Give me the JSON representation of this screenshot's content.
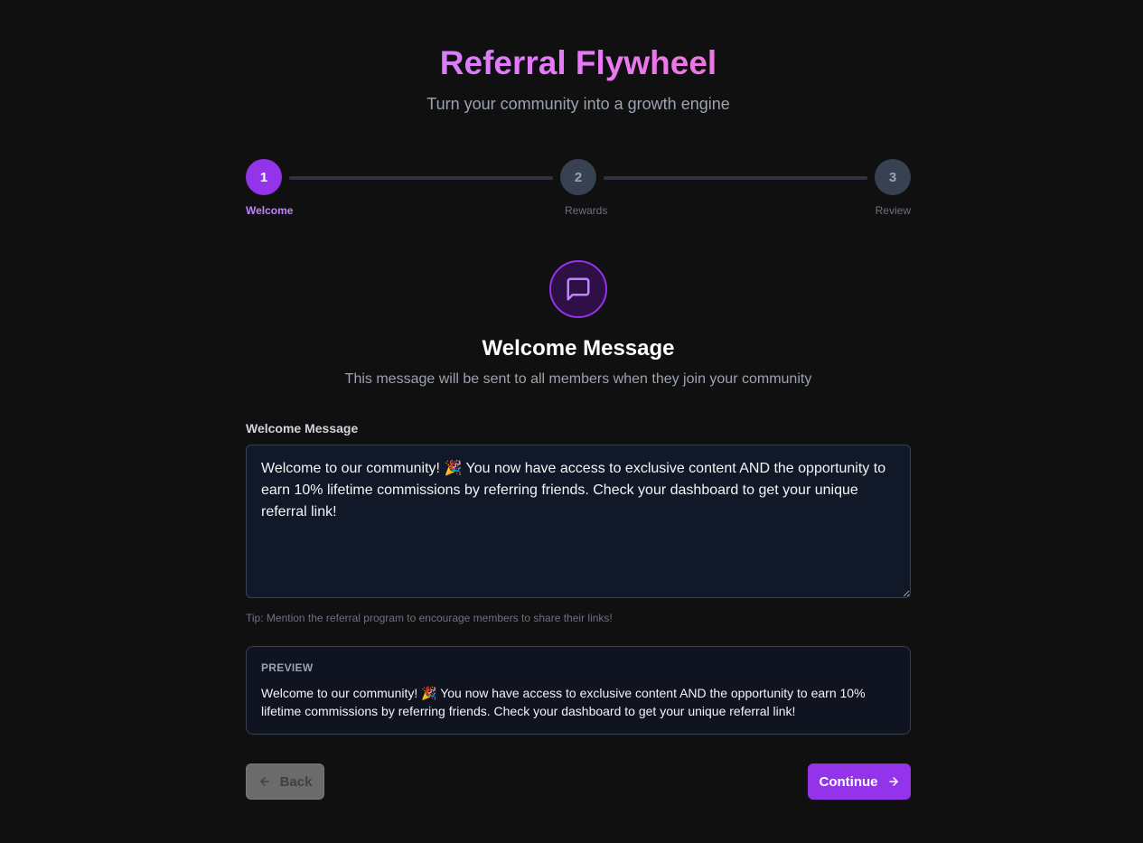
{
  "header": {
    "title": "Referral Flywheel",
    "subtitle": "Turn your community into a growth engine"
  },
  "stepper": {
    "steps": [
      {
        "number": "1",
        "label": "Welcome",
        "state": "active"
      },
      {
        "number": "2",
        "label": "Rewards",
        "state": "inactive"
      },
      {
        "number": "3",
        "label": "Review",
        "state": "inactive"
      }
    ]
  },
  "section": {
    "icon": "message-square-icon",
    "title": "Welcome Message",
    "description": "This message will be sent to all members when they join your community"
  },
  "form": {
    "label": "Welcome Message",
    "value": "Welcome to our community! 🎉 You now have access to exclusive content AND the opportunity to earn 10% lifetime commissions by referring friends. Check your dashboard to get your unique referral link!",
    "tip": "Tip: Mention the referral program to encourage members to share their links!"
  },
  "preview": {
    "label": "PREVIEW",
    "text": "Welcome to our community! 🎉 You now have access to exclusive content AND the opportunity to earn 10% lifetime commissions by referring friends. Check your dashboard to get your unique referral link!"
  },
  "actions": {
    "back_label": "Back",
    "continue_label": "Continue"
  },
  "colors": {
    "accent": "#9333ea",
    "background": "#101010"
  }
}
